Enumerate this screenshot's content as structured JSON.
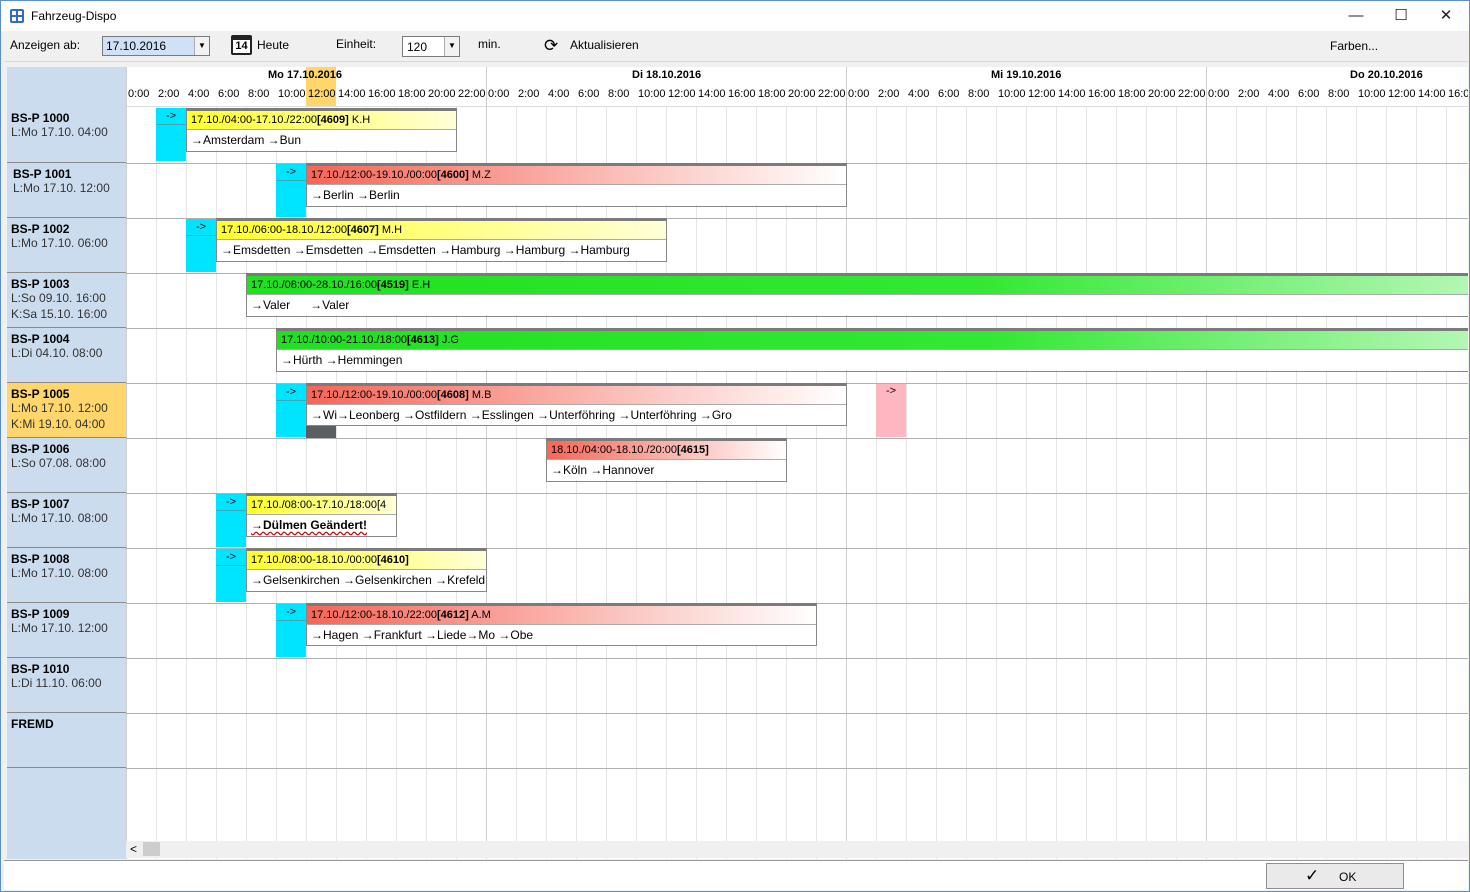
{
  "window": {
    "title": "Fahrzeug-Dispo",
    "minimize": "—",
    "maximize": "☐",
    "close": "✕"
  },
  "toolbar": {
    "show_from_label": "Anzeigen ab:",
    "date_value": "17.10.2016",
    "today_label": "Heute",
    "calendar_icon_text": "14",
    "unit_label": "Einheit:",
    "unit_value": "120",
    "unit_suffix": "min.",
    "refresh_label": "Aktualisieren",
    "colors_label": "Farben..."
  },
  "timeline": {
    "days": [
      {
        "label": "Mo 17.10.2016"
      },
      {
        "label": "Di 18.10.2016"
      },
      {
        "label": "Mi 19.10.2016"
      },
      {
        "label": "Do 20.10.2016"
      }
    ],
    "hours": [
      "0:00",
      "2:00",
      "4:00",
      "6:00",
      "8:00",
      "10:00",
      "12:00",
      "14:00",
      "16:00",
      "18:00",
      "20:00",
      "22:00",
      "0:00",
      "2:00",
      "4:00",
      "6:00",
      "8:00",
      "10:00",
      "12:00",
      "14:00",
      "16:00",
      "18:00",
      "20:00",
      "22:00",
      "0:00",
      "2:00",
      "4:00",
      "6:00",
      "8:00",
      "10:00",
      "12:00",
      "14:00",
      "16:00",
      "18:00",
      "20:00",
      "22:00",
      "0:00",
      "2:00",
      "4:00",
      "6:00",
      "8:00",
      "10:00",
      "12:00",
      "14:00",
      "16:0"
    ],
    "current_hour": "12:00"
  },
  "vehicles": [
    {
      "name": "BS-P 1000",
      "l": "L:Mo 17.10. 04:00",
      "k": ""
    },
    {
      "name": "BS-P 1001",
      "l": "L:Mo 17.10. 12:00",
      "k": ""
    },
    {
      "name": "BS-P 1002",
      "l": "L:Mo 17.10. 06:00",
      "k": ""
    },
    {
      "name": "BS-P 1003",
      "l": "L:So 09.10. 16:00",
      "k": "K:Sa 15.10. 16:00"
    },
    {
      "name": "BS-P 1004",
      "l": "L:Di 04.10. 08:00",
      "k": ""
    },
    {
      "name": "BS-P 1005",
      "l": "L:Mo 17.10. 12:00",
      "k": "K:Mi 19.10. 04:00"
    },
    {
      "name": "BS-P 1006",
      "l": "L:So 07.08. 08:00",
      "k": ""
    },
    {
      "name": "BS-P 1007",
      "l": "L:Mo 17.10. 08:00",
      "k": ""
    },
    {
      "name": "BS-P 1008",
      "l": "L:Mo 17.10. 08:00",
      "k": ""
    },
    {
      "name": "BS-P 1009",
      "l": "L:Mo 17.10. 12:00",
      "k": ""
    },
    {
      "name": "BS-P 1010",
      "l": "L:Di 11.10. 06:00",
      "k": ""
    },
    {
      "name": "FREMD",
      "l": "",
      "k": ""
    }
  ],
  "marker_text": "->",
  "trips": [
    {
      "time": "17.10./04:00-17.10./22:00",
      "id": "[4609]",
      "driver": "K.H",
      "route": "→Amsterdam →Bun"
    },
    {
      "time": "17.10./12:00-19.10./00:00",
      "id": "[4600]",
      "driver": "M.Z",
      "route": "→Berlin →Berlin"
    },
    {
      "time": "17.10./06:00-18.10./12:00",
      "id": "[4607]",
      "driver": "M.H",
      "route": "→Emsdetten →Emsdetten →Emsdetten →Hamburg →Hamburg →Hamburg"
    },
    {
      "time": "17.10./08:00-28.10./16:00",
      "id": "[4519]",
      "driver": "E.H",
      "route": "→Valer      →Valer"
    },
    {
      "time": "17.10./10:00-21.10./18:00",
      "id": "[4613]",
      "driver": "J.G",
      "route": "→Hürth →Hemmingen"
    },
    {
      "time": "17.10./12:00-19.10./00:00",
      "id": "[4608]",
      "driver": "M.B",
      "route": "→Wi→Leonberg →Ostfildern →Esslingen →Unterföhring →Unterföhring →Gro"
    },
    {
      "time": "18.10./04:00-18.10./20:00",
      "id": "[4615]",
      "driver": "",
      "route": "→Köln →Hannover"
    },
    {
      "time": "17.10./08:00-17.10./18:00",
      "id": "[4",
      "driver": "",
      "route": "→Dülmen Geändert!"
    },
    {
      "time": "17.10./08:00-18.10./00:00",
      "id": "[4610]",
      "driver": "",
      "route": "→Gelsenkirchen →Gelsenkirchen →Krefeld"
    },
    {
      "time": "17.10./12:00-18.10./22:00",
      "id": "[4612]",
      "driver": "A.M",
      "route": "→Hagen →Frankfurt →Liede→Mo →Obe"
    }
  ],
  "colors": {
    "cyan": "#00e5ff",
    "yellow": "#ffff2a",
    "red": "#f56658",
    "green": "#20e020",
    "pink": "#ffb6c1",
    "highlight": "#ffd66b",
    "sidebar": "#ccdcef"
  },
  "footer": {
    "ok_label": "OK",
    "scroll_left": "<"
  }
}
